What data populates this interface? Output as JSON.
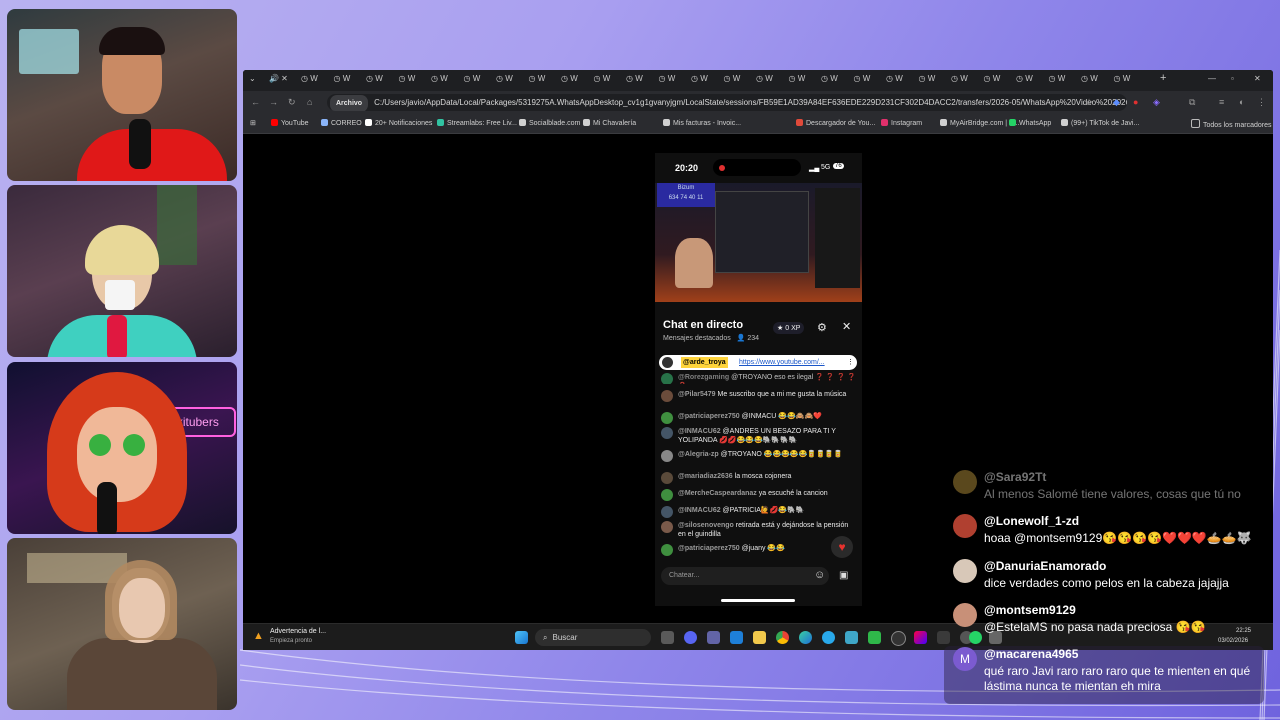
{
  "browser": {
    "tab_glyph": "W",
    "address": {
      "chip": "Archivo",
      "url": "C:/Users/javio/AppData/Local/Packages/5319275A.WhatsAppDesktop_cv1g1gvanyjgm/LocalState/sessions/FB59E1AD39A84EF636EDE229D231CF302D4DACC2/transfers/2026-05/WhatsApp%20Video%202026-02..."
    },
    "bookmarks": [
      {
        "label": "YouTube",
        "color": "#ff0000"
      },
      {
        "label": "CORREO",
        "color": "#8ab4f8"
      },
      {
        "label": "20+ Notificaciones",
        "color": "#ffffff"
      },
      {
        "label": "Streamlabs: Free Liv...",
        "color": "#31c3a2"
      },
      {
        "label": "Socialblade.com",
        "color": "#d0d0d0"
      },
      {
        "label": "Mi Chavalería",
        "color": "#d0d0d0"
      },
      {
        "label": "Mis facturas - Invoic...",
        "color": "#d0d0d0"
      },
      {
        "label": "Descargador de You...",
        "color": "#e04a3a"
      },
      {
        "label": "Instagram",
        "color": "#e1306c"
      },
      {
        "label": "MyAirBridge.com | E...",
        "color": "#d0d0d0"
      },
      {
        "label": "WhatsApp",
        "color": "#25d366"
      },
      {
        "label": "(99+) TikTok de Javi...",
        "color": "#d0d0d0"
      }
    ],
    "all_bookmarks": "Todos los marcadores"
  },
  "phone": {
    "time": "20:20",
    "network": "5G",
    "battery": "76",
    "video_overlay": {
      "line1": "Bizum",
      "line2": "634 74 40 11"
    },
    "chat_title": "Chat en directo",
    "chat_subtitle": "Mensajes destacados",
    "viewers": "234",
    "xp": "0 XP",
    "pinned": {
      "user": "@arde_troya",
      "link": "https://www.youtube.com/..."
    },
    "messages": [
      {
        "user": "@Rorezgaming",
        "text": "@TROYANO eso es ilegal ❓ ❓ ❓ ❓ ❓ creo que no",
        "color": "#2e8b57"
      },
      {
        "user": "@Pilar5479",
        "text": "Me suscribo que a mi me gusta la música",
        "color": "#6b4c3b"
      },
      {
        "user": "@patriciaperez750",
        "text": "@INMACU 😂😂🙈🙈❤️",
        "color": "#3f8f3f"
      },
      {
        "user": "@INMACU62",
        "text": "@ANDRES UN BESAZO PARA TI Y YOLIPANDA 💋💋😂😂😂🐘🐘🐘🐘",
        "color": "#445566"
      },
      {
        "user": "@Alegria-zp",
        "text": "@TROYANO 😂😂😂😂😂🥫🥫🥫🥫",
        "color": "#888888"
      },
      {
        "user": "@mariadiaz2636",
        "text": "la mosca cojonera",
        "color": "#5a4a3a"
      },
      {
        "user": "@MercheCaspeardanaz",
        "text": "ya escuché la cancion",
        "color": "#3f8f3f"
      },
      {
        "user": "@INMACU62",
        "text": "@PATRICIA🙋💋😂🐘🐘",
        "color": "#445566"
      },
      {
        "user": "@silosenovengo",
        "text": "retirada está y dejándose la pensión en el guindilla",
        "color": "#7a5a4a"
      },
      {
        "user": "@patriciaperez750",
        "text": "@juany 😂😂",
        "color": "#3f8f3f"
      }
    ],
    "input_placeholder": "Chatear..."
  },
  "taskbar": {
    "notification_title": "Advertencia de l...",
    "notification_sub": "Empieza pronto",
    "search_placeholder": "Buscar",
    "time": "22:25",
    "date": "03/02/2026"
  },
  "overlay_chat": [
    {
      "name": "@Sara92Tt",
      "text": "Al menos Salomé tiene valores, cosas que tú no",
      "faded": true,
      "avatar": "#c8a040"
    },
    {
      "name": "@Lonewolf_1-zd",
      "text": "hoaa @montsem9129😘😘😘😘❤️❤️❤️🥧🥧🐺",
      "faded": false,
      "avatar": "#b04030"
    },
    {
      "name": "@DanuriaEnamorado",
      "text": "dice verdades como pelos en la cabeza jajajja",
      "faded": false,
      "avatar": "#d8c8b8"
    },
    {
      "name": "@montsem9129",
      "text": "@EstelaMS no pasa nada preciosa 😘😘",
      "faded": false,
      "avatar": "#c89078"
    },
    {
      "name": "@macarena4965",
      "text": "qué raro Javi raro raro raro que te mienten en qué lástima nunca te mientan eh mira",
      "faded": false,
      "avatar": "#7b5bd0",
      "initial": "M"
    }
  ]
}
